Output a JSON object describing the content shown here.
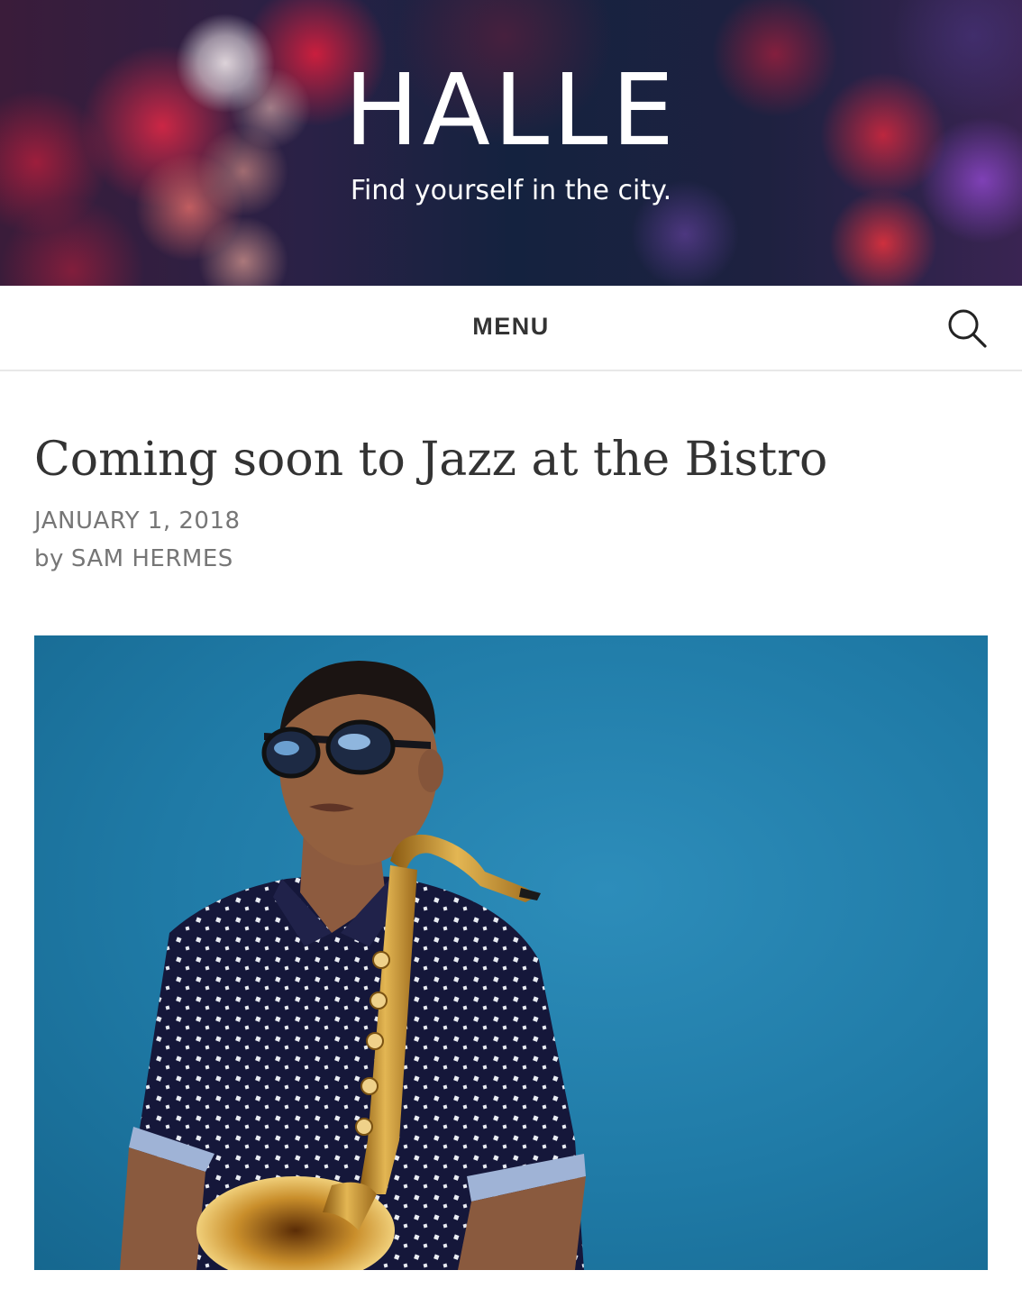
{
  "header": {
    "site_title": "HALLE",
    "tagline": "Find yourself in the city."
  },
  "nav": {
    "menu_label": "MENU",
    "search_icon": "search-icon"
  },
  "post": {
    "title": "Coming soon to Jazz at the Bistro",
    "date": "JANUARY 1, 2018",
    "byline_prefix": "by",
    "author": "SAM HERMES",
    "featured_image": "saxophonist-photo"
  },
  "colors": {
    "text_dark": "#333333",
    "text_meta": "#767676",
    "nav_border": "#e8e8e8",
    "image_background": "#1f7aa6"
  }
}
